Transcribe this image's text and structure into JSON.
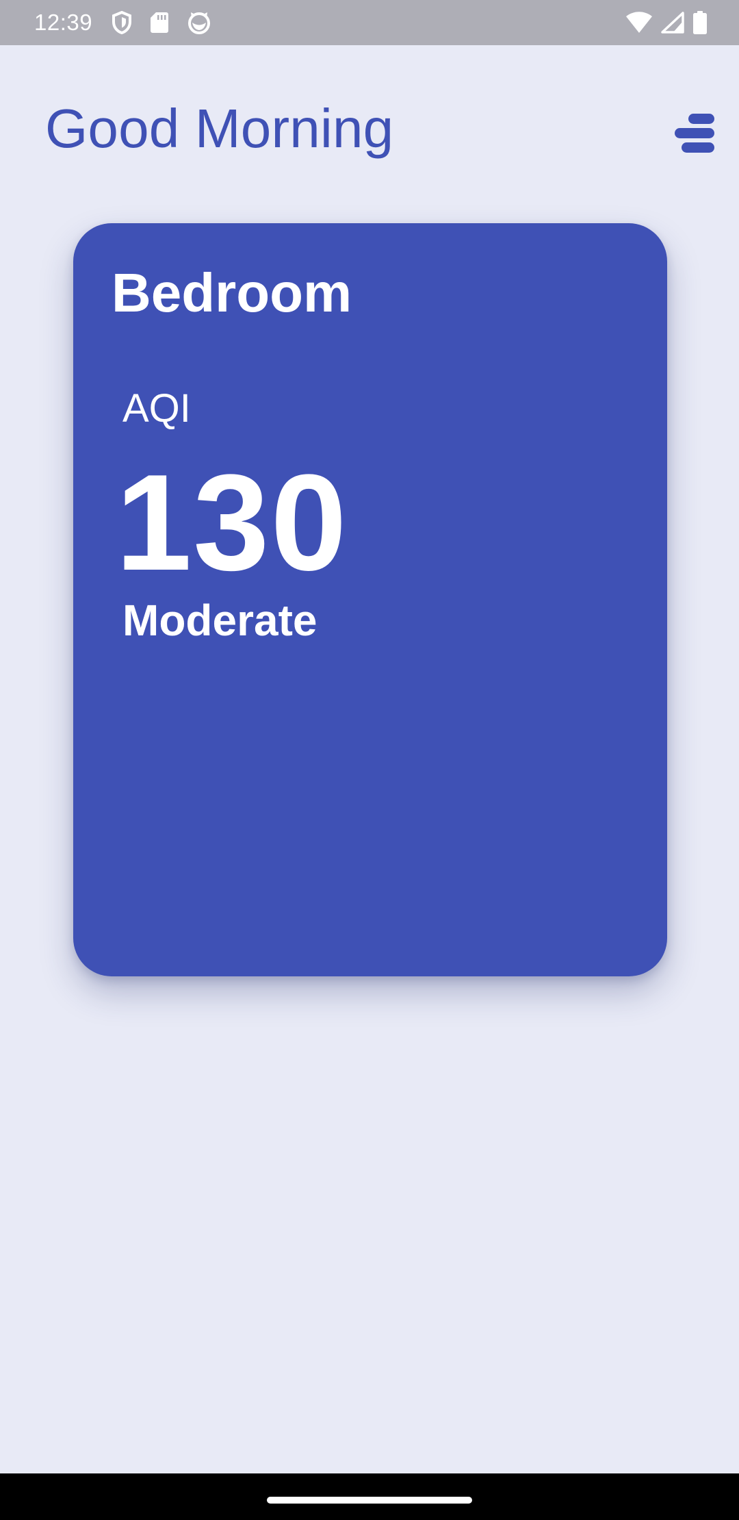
{
  "status_bar": {
    "time": "12:39",
    "left_icons": [
      "shield-icon",
      "sd-card-icon",
      "cat-face-icon"
    ],
    "right_icons": [
      "wifi-icon",
      "cellular-signal-icon",
      "battery-icon"
    ]
  },
  "header": {
    "greeting": "Good Morning",
    "menu_icon": "menu-icon"
  },
  "room_card": {
    "room_name": "Bedroom",
    "metric_label": "AQI",
    "metric_value": "130",
    "metric_status": "Moderate"
  },
  "colors": {
    "background": "#e8eaf6",
    "accent": "#3f51b5",
    "status_bar": "#aeaeb6",
    "nav_bar": "#000000"
  }
}
